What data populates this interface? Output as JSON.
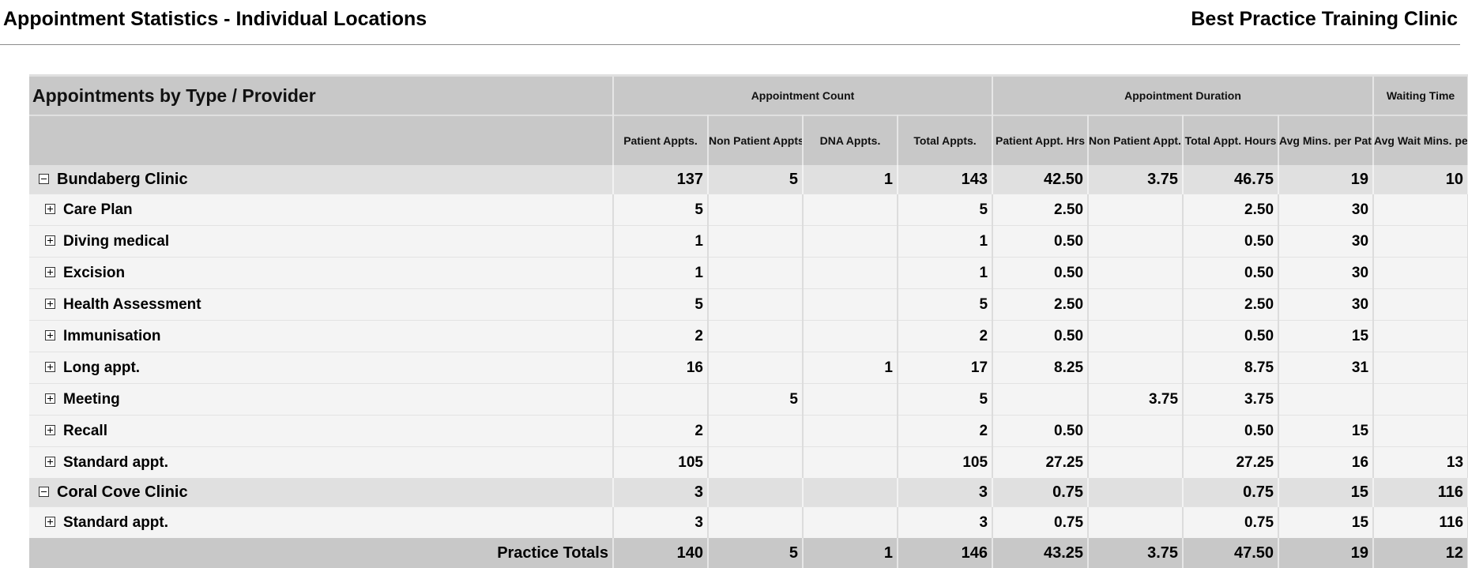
{
  "page": {
    "title": "Appointment Statistics - Individual Locations",
    "practice": "Best Practice Training Clinic"
  },
  "table": {
    "title": "Appointments by Type / Provider",
    "groups": {
      "count": "Appointment Count",
      "duration": "Appointment Duration",
      "waiting": "Waiting Time"
    },
    "columns": {
      "patient_appts": "Patient Appts.",
      "non_patient_appts": "Non Patient Appts.",
      "dna_appts": "DNA Appts.",
      "total_appts": "Total Appts.",
      "patient_hrs": "Patient Appt. Hrs",
      "non_patient_hrs": "Non Patient Appt. Hrs",
      "total_hrs": "Total Appt. Hours",
      "avg_mins": "Avg Mins. per Patient appt.",
      "avg_wait": "Avg Wait Mins. per Patient appt."
    },
    "locations": [
      {
        "name": "Bundaberg Clinic",
        "values": [
          "137",
          "5",
          "1",
          "143",
          "42.50",
          "3.75",
          "46.75",
          "19",
          "10"
        ],
        "rows": [
          {
            "name": "Care Plan",
            "values": [
              "5",
              "",
              "",
              "5",
              "2.50",
              "",
              "2.50",
              "30",
              ""
            ]
          },
          {
            "name": "Diving medical",
            "values": [
              "1",
              "",
              "",
              "1",
              "0.50",
              "",
              "0.50",
              "30",
              ""
            ]
          },
          {
            "name": "Excision",
            "values": [
              "1",
              "",
              "",
              "1",
              "0.50",
              "",
              "0.50",
              "30",
              ""
            ]
          },
          {
            "name": "Health Assessment",
            "values": [
              "5",
              "",
              "",
              "5",
              "2.50",
              "",
              "2.50",
              "30",
              ""
            ]
          },
          {
            "name": "Immunisation",
            "values": [
              "2",
              "",
              "",
              "2",
              "0.50",
              "",
              "0.50",
              "15",
              ""
            ]
          },
          {
            "name": "Long appt.",
            "values": [
              "16",
              "",
              "1",
              "17",
              "8.25",
              "",
              "8.75",
              "31",
              ""
            ]
          },
          {
            "name": "Meeting",
            "values": [
              "",
              "5",
              "",
              "5",
              "",
              "3.75",
              "3.75",
              "",
              ""
            ]
          },
          {
            "name": "Recall",
            "values": [
              "2",
              "",
              "",
              "2",
              "0.50",
              "",
              "0.50",
              "15",
              ""
            ]
          },
          {
            "name": "Standard appt.",
            "values": [
              "105",
              "",
              "",
              "105",
              "27.25",
              "",
              "27.25",
              "16",
              "13"
            ]
          }
        ]
      },
      {
        "name": "Coral Cove Clinic",
        "values": [
          "3",
          "",
          "",
          "3",
          "0.75",
          "",
          "0.75",
          "15",
          "116"
        ],
        "rows": [
          {
            "name": "Standard appt.",
            "values": [
              "3",
              "",
              "",
              "3",
              "0.75",
              "",
              "0.75",
              "15",
              "116"
            ]
          }
        ]
      }
    ],
    "totals": {
      "label": "Practice Totals",
      "values": [
        "140",
        "5",
        "1",
        "146",
        "43.25",
        "3.75",
        "47.50",
        "19",
        "12"
      ]
    }
  }
}
